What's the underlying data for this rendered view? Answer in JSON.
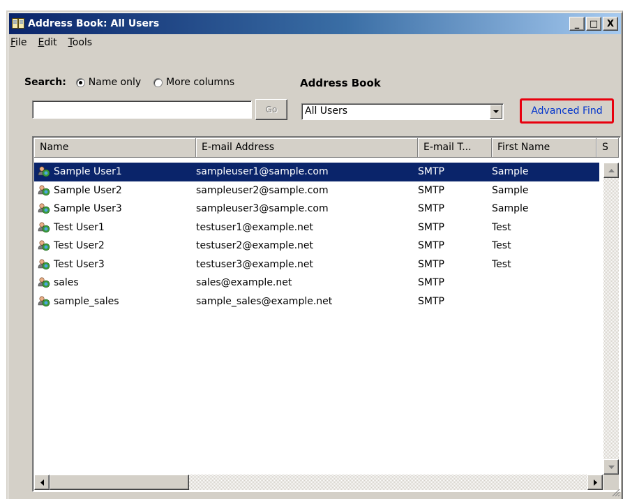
{
  "window": {
    "title": "Address Book: All Users",
    "minimize_glyph": "_",
    "maximize_glyph": "□",
    "close_glyph": "X"
  },
  "menu": [
    {
      "label": "File",
      "accel": "F",
      "rest": "ile"
    },
    {
      "label": "Edit",
      "accel": "E",
      "rest": "dit"
    },
    {
      "label": "Tools",
      "accel": "T",
      "rest": "ools"
    }
  ],
  "search": {
    "label": "Search:",
    "option_name_only": "Name only",
    "option_more_columns": "More columns",
    "selected": "Name only",
    "input_value": "",
    "go_label": "Go"
  },
  "address_book": {
    "label": "Address Book",
    "selected": "All Users"
  },
  "advanced_find": {
    "label": "Advanced Find",
    "highlight_color": "#e8000e"
  },
  "columns": [
    "Name",
    "E-mail Address",
    "E-mail T...",
    "First Name",
    "S"
  ],
  "rows": [
    {
      "name": "Sample User1",
      "email": "sampleuser1@sample.com",
      "type": "SMTP",
      "first": "Sample",
      "selected": true
    },
    {
      "name": "Sample User2",
      "email": "sampleuser2@sample.com",
      "type": "SMTP",
      "first": "Sample",
      "selected": false
    },
    {
      "name": "Sample User3",
      "email": "sampleuser3@sample.com",
      "type": "SMTP",
      "first": "Sample",
      "selected": false
    },
    {
      "name": "Test User1",
      "email": "testuser1@example.net",
      "type": "SMTP",
      "first": "Test",
      "selected": false
    },
    {
      "name": "Test User2",
      "email": "testuser2@example.net",
      "type": "SMTP",
      "first": "Test",
      "selected": false
    },
    {
      "name": "Test User3",
      "email": "testuser3@example.net",
      "type": "SMTP",
      "first": "Test",
      "selected": false
    },
    {
      "name": "sales",
      "email": "sales@example.net",
      "type": "SMTP",
      "first": "",
      "selected": false
    },
    {
      "name": "sample_sales",
      "email": "sample_sales@example.net",
      "type": "SMTP",
      "first": "",
      "selected": false
    }
  ],
  "icons": {
    "title": "address-book-icon",
    "row": "person-icon"
  },
  "colors": {
    "title_start": "#0a246a",
    "title_end": "#a6caf0",
    "selection": "#0a246a",
    "link": "#0033cc",
    "chrome": "#d4d0c8"
  }
}
